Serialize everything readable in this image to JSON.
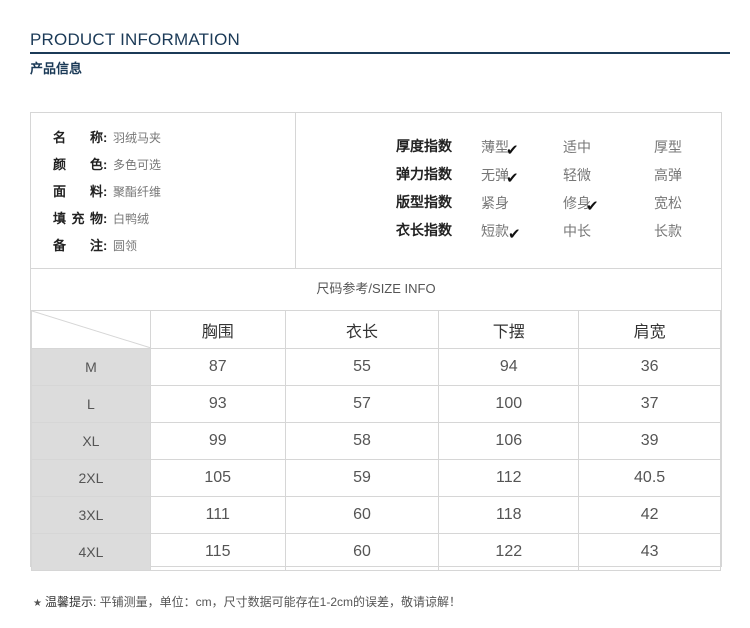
{
  "header": {
    "title": "PRODUCT INFORMATION",
    "subtitle": "产品信息"
  },
  "product_info": [
    {
      "label": "名 称",
      "value": "羽绒马夹"
    },
    {
      "label": "颜 色",
      "value": "多色可选"
    },
    {
      "label": "面 料",
      "value": "聚酯纤维"
    },
    {
      "label": "填充物",
      "value": "白鸭绒"
    },
    {
      "label": "备 注",
      "value": "圆领"
    }
  ],
  "indices": [
    {
      "label": "厚度指数",
      "options": [
        "薄型",
        "适中",
        "厚型"
      ],
      "selected": "薄型"
    },
    {
      "label": "弹力指数",
      "options": [
        "无弹",
        "轻微",
        "高弹"
      ],
      "selected": "无弹"
    },
    {
      "label": "版型指数",
      "options": [
        "紧身",
        "修身",
        "宽松"
      ],
      "selected": "修身"
    },
    {
      "label": "衣长指数",
      "options": [
        "短款",
        "中长",
        "长款"
      ],
      "selected": "短款"
    }
  ],
  "check_icon": "check-icon",
  "size_table": {
    "title": "尺码参考/SIZE INFO",
    "columns": [
      "胸围",
      "衣长",
      "下摆",
      "肩宽"
    ],
    "rows": [
      {
        "size": "M",
        "values": [
          "87",
          "55",
          "94",
          "36"
        ]
      },
      {
        "size": "L",
        "values": [
          "93",
          "57",
          "100",
          "37"
        ]
      },
      {
        "size": "XL",
        "values": [
          "99",
          "58",
          "106",
          "39"
        ]
      },
      {
        "size": "2XL",
        "values": [
          "105",
          "59",
          "112",
          "40.5"
        ]
      },
      {
        "size": "3XL",
        "values": [
          "111",
          "60",
          "118",
          "42"
        ]
      },
      {
        "size": "4XL",
        "values": [
          "115",
          "60",
          "122",
          "43"
        ]
      }
    ]
  },
  "note": {
    "star": "★",
    "label": "温馨提示:",
    "text": "平铺测量，单位：cm，尺寸数据可能存在1-2cm的误差，敬请谅解！"
  },
  "colors": {
    "header": "#1b3a57",
    "border": "#d6d6d6",
    "size_cell_bg": "#dcdcdc"
  }
}
